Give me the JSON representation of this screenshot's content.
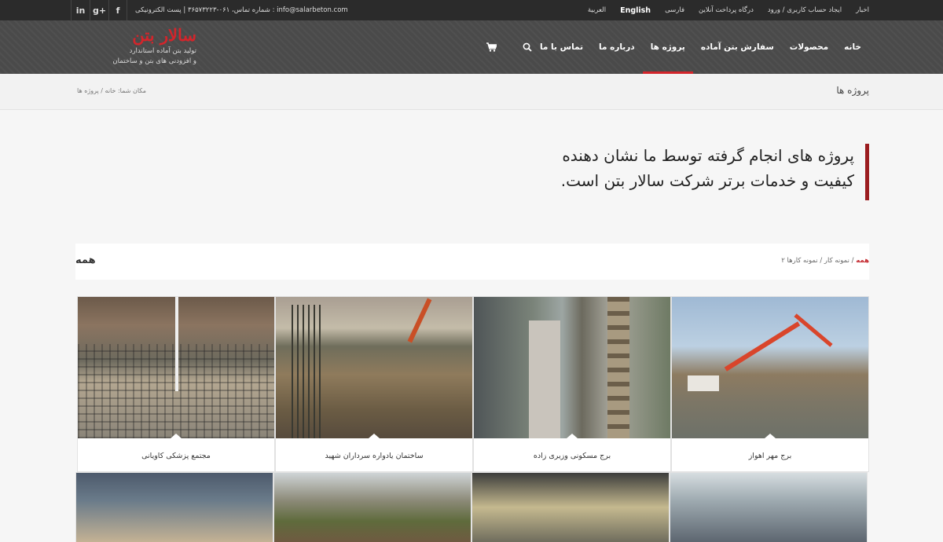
{
  "topbar": {
    "social": [
      "in",
      "g+",
      "f"
    ],
    "contact": "info@salarbeton.com : شماره تماس، ۰۶۱-۳۶۵۷۳۲۲۳ | پست الکترونیکی",
    "links": [
      "اخبار",
      "ایجاد حساب کاربری / ورود",
      "درگاه پرداخت آنلاین",
      "فارسی",
      "English",
      "العربية"
    ]
  },
  "logo": {
    "name": "سالار بتن",
    "tagline1": "تولید بتن آماده استاندارد",
    "tagline2": "و افزودنی های بتن و ساختمان"
  },
  "nav": {
    "items": [
      "خانه",
      "محصولات",
      "سفارش بتن آماده",
      "پروژه ها",
      "درباره ما",
      "تماس با ما"
    ],
    "active": "پروژه ها"
  },
  "icons": {
    "cart": "cart-icon",
    "search": "search-icon"
  },
  "breadcrumb": {
    "page_title": "پروژه ها",
    "trail": "مکان شما: خانه / پروژه ها"
  },
  "intro": {
    "line1": "پروژه های انجام گرفته توسط ما نشان دهنده",
    "line2": "کیفیت و خدمات برتر شرکت سالار بتن است."
  },
  "filter": {
    "current": "همه",
    "options": [
      "همه",
      "نمونه کار",
      "نمونه کارها ۲"
    ]
  },
  "projects": [
    {
      "title": "برج مهر اهواز"
    },
    {
      "title": "برج مسکونی وزیری زاده"
    },
    {
      "title": "ساختمان یادواره سرداران شهید"
    },
    {
      "title": "مجتمع پزشکی کاویانی"
    }
  ],
  "colors": {
    "accent": "#d3252b",
    "dark": "#2b2b2b",
    "header": "#4a4a4a"
  }
}
